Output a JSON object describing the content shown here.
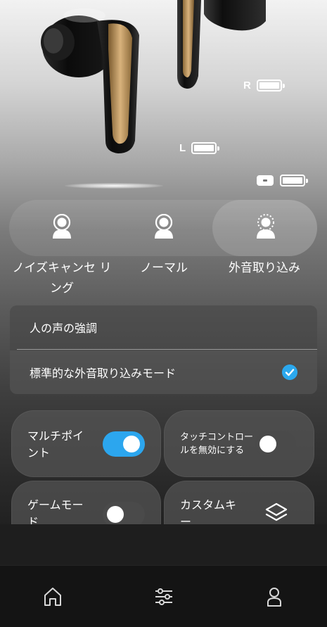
{
  "battery": {
    "right_label": "R",
    "left_label": "L",
    "right_level": 1.0,
    "left_level": 1.0,
    "case_level": 1.0
  },
  "modes": {
    "items": [
      {
        "label": "ノイズキャンセ\nリング",
        "icon": "anc-person-icon",
        "active": false
      },
      {
        "label": "ノーマル",
        "icon": "normal-person-icon",
        "active": false
      },
      {
        "label": "外音取り込み",
        "icon": "ambient-person-icon",
        "active": true
      }
    ]
  },
  "ambient": {
    "voice_enhance_label": "人の声の強調",
    "standard_label": "標準的な外音取り込みモード",
    "standard_selected": true
  },
  "features": {
    "multipoint_label": "マルチポイ\nント",
    "multipoint_on": true,
    "touch_disable_label": "タッチコントロー\nルを無効にする",
    "touch_disable_on": false,
    "game_mode_label": "ゲームモー\nド",
    "game_mode_on": false,
    "custom_key_label": "カスタムキ\nー",
    "custom_key_icon": "layers-icon"
  },
  "nav": {
    "items": [
      {
        "icon": "home-icon"
      },
      {
        "icon": "sliders-icon"
      },
      {
        "icon": "profile-icon"
      }
    ]
  },
  "colors": {
    "accent": "#2ca6ee",
    "check": "#2ba8ee"
  }
}
